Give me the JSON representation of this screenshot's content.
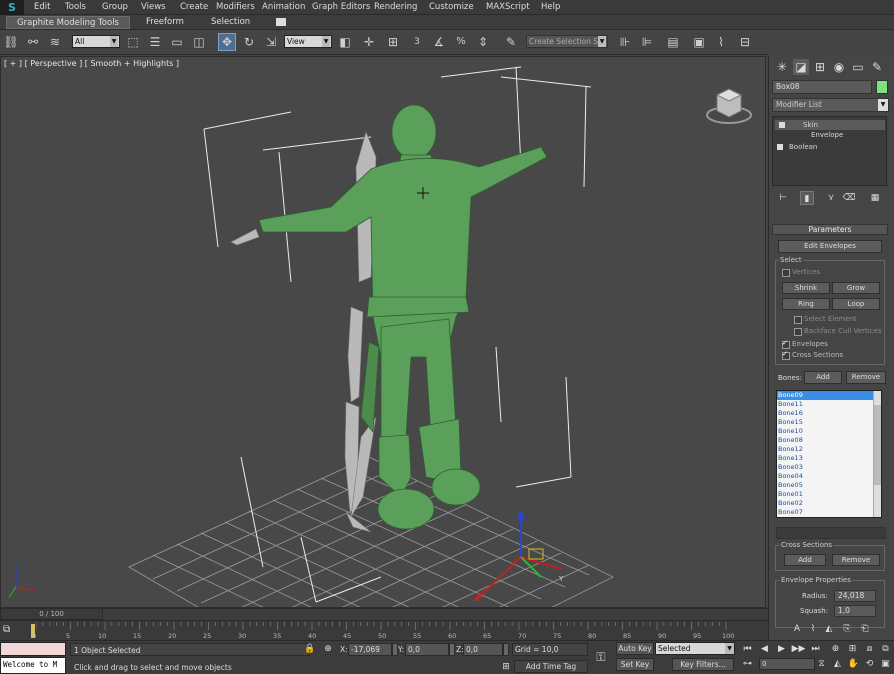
{
  "app": {
    "logo_glyph": "S"
  },
  "menu": [
    "Edit",
    "Tools",
    "Group",
    "Views",
    "Create",
    "Modifiers",
    "Animation",
    "Graph Editors",
    "Rendering",
    "Customize",
    "MAXScript",
    "Help"
  ],
  "ribbon": {
    "tabs": [
      "Graphite Modeling Tools",
      "Freeform",
      "Selection"
    ]
  },
  "toolbar": {
    "selection_filter": "All",
    "ref_coord": "View",
    "named_selection_placeholder": "Create Selection S",
    "snap_label": "3"
  },
  "viewport": {
    "label": "[ + ] [ Perspective ] [ Smooth + Highlights ]",
    "colors": {
      "body": "#5aa05a",
      "grid": "#9a9a9a",
      "bounds": "#e8e8e8",
      "bone": "#b8b8b8"
    }
  },
  "command_panel": {
    "object_name": "Box08",
    "object_color": "#7ee07e",
    "modifier_list_label": "Modifier List",
    "stack": [
      {
        "label": "Skin"
      },
      {
        "label": "Envelope"
      },
      {
        "label": "Boolean"
      }
    ],
    "parameters": {
      "title": "Parameters",
      "edit_envelopes": "Edit Envelopes",
      "select_group": "Select",
      "vertices": "Vertices",
      "shrink": "Shrink",
      "grow": "Grow",
      "ring": "Ring",
      "loop": "Loop",
      "select_element": "Select Element",
      "backface_cull": "Backface Cull Vertices",
      "envelopes": "Envelopes",
      "cross_sections": "Cross Sections",
      "bones_label": "Bones:",
      "add": "Add",
      "remove": "Remove",
      "bones": [
        "Bone09",
        "Bone11",
        "Bone16",
        "Bone15",
        "Bone10",
        "Bone08",
        "Bone12",
        "Bone13",
        "Bone03",
        "Bone04",
        "Bone05",
        "Bone01",
        "Bone02",
        "Bone07"
      ],
      "cross_sections_group": "Cross Sections",
      "cs_add": "Add",
      "cs_remove": "Remove",
      "envelope_props_group": "Envelope Properties",
      "radius_label": "Radius:",
      "radius_value": "24,018",
      "squash_label": "Squash:",
      "squash_value": "1,0"
    }
  },
  "timeline": {
    "slider_label": "0 / 100",
    "ticks": [
      "0",
      "5",
      "10",
      "15",
      "20",
      "25",
      "30",
      "35",
      "40",
      "45",
      "50",
      "55",
      "60",
      "65",
      "70",
      "75",
      "80",
      "85",
      "90",
      "95",
      "100"
    ]
  },
  "status": {
    "maxscript": "Welcome to M",
    "selected": "1 Object Selected",
    "prompt": "Click and drag to select and move objects",
    "x_label": "X:",
    "x_value": "-17,069",
    "y_label": "Y:",
    "y_value": "0,0",
    "z_label": "Z:",
    "z_value": "0,0",
    "grid": "Grid = 10,0",
    "add_time_tag": "Add Time Tag",
    "auto_key": "Auto Key",
    "auto_key_target": "Selected",
    "set_key": "Set Key",
    "key_filters": "Key Filters...",
    "current_frame": "0"
  }
}
